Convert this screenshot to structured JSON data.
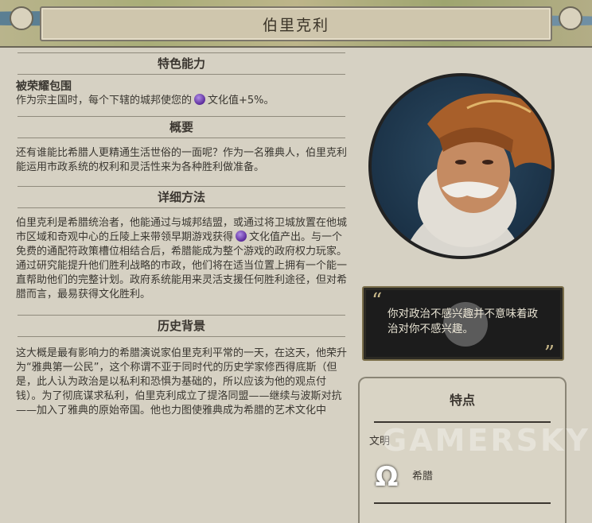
{
  "header": {
    "title": "伯里克利"
  },
  "sections": {
    "ability": {
      "heading": "特色能力",
      "name": "被荣耀包围",
      "desc_before": "作为宗主国时，每个下辖的城邦使您的",
      "desc_after": "文化值+5%。"
    },
    "overview": {
      "heading": "概要",
      "body": "还有谁能比希腊人更精通生活世俗的一面呢？作为一名雅典人，伯里克利能运用市政系统的权利和灵活性来为各种胜利做准备。"
    },
    "detailed": {
      "heading": "详细方法",
      "body_before": "伯里克利是希腊统治者，他能通过与城邦结盟，或通过将卫城放置在他城市区域和奇观中心的丘陵上来带领早期游戏获得",
      "body_after": "文化值产出。与一个免费的通配符政策槽位相结合后，希腊能成为整个游戏的政府权力玩家。通过研究能提升他们胜利战略的市政，他们将在适当位置上拥有一个能一直帮助他们的完整计划。政府系统能用来灵活支援任何胜利途径，但对希腊而言，最易获得文化胜利。"
    },
    "history": {
      "heading": "历史背景",
      "body": "这大概是最有影响力的希腊演说家伯里克利平常的一天，在这天，他荣升为“雅典第一公民”，这个称谓不亚于同时代的历史学家修西得底斯（但是，此人认为政治是以私利和恐惧为基础的，所以应该为他的观点付钱）。为了彻底谋求私利，伯里克利成立了提洛同盟——继续与波斯对抗——加入了雅典的原始帝国。他也力图使雅典成为希腊的艺术文化中"
    }
  },
  "quote": {
    "text": "你对政治不感兴趣并不意味着政治对你不感兴趣。"
  },
  "traits": {
    "title": "特点",
    "category": "文明",
    "civ_name": "希腊"
  },
  "watermark": "GAMERSKY",
  "colors": {
    "background": "#d6d1c3",
    "quote_bg": "#1c1c1c",
    "culture_icon": "#6a35a8"
  }
}
